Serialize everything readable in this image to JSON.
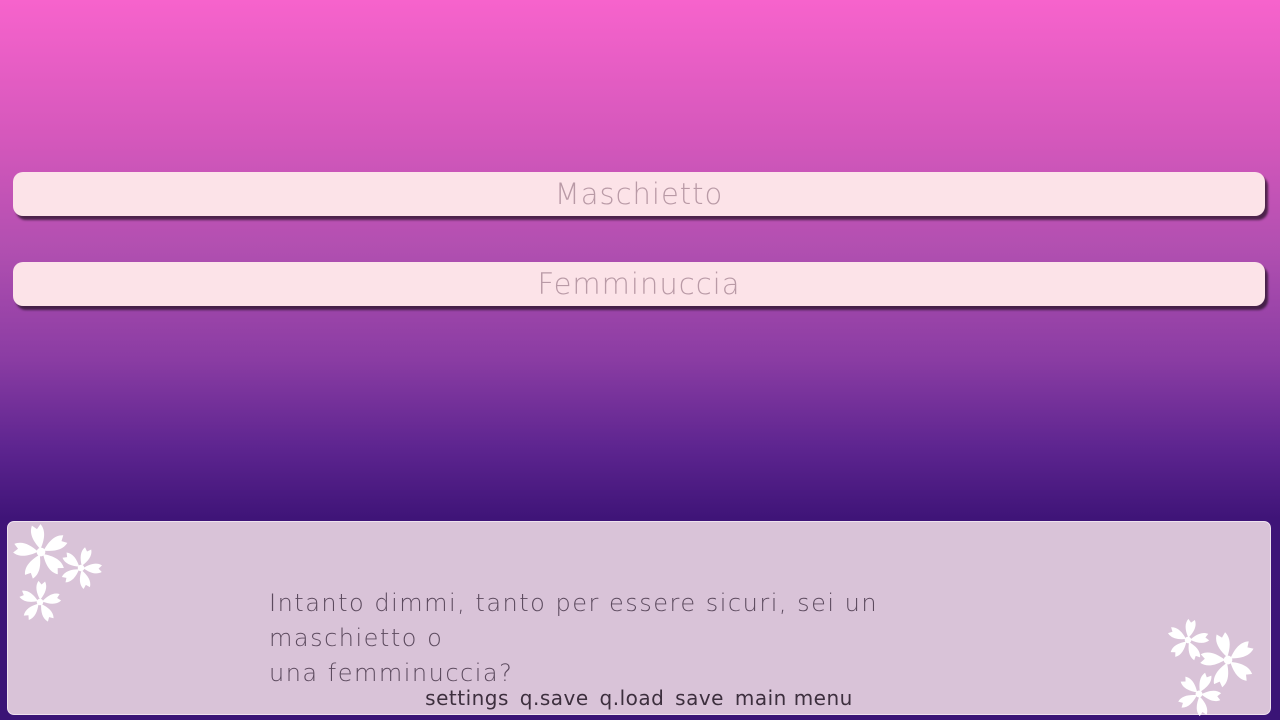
{
  "choices": [
    {
      "label": "Maschietto"
    },
    {
      "label": "Femminuccia"
    }
  ],
  "dialogue": {
    "line1": "Intanto dimmi, tanto per essere sicuri, sei un maschietto o",
    "line2": "una femminuccia?"
  },
  "quick_menu": {
    "settings": "settings",
    "qsave": "q.save",
    "qload": "q.load",
    "save": "save",
    "main_menu": "main menu"
  },
  "colors": {
    "bg_top": "#f763cc",
    "bg_bottom": "#3a1476",
    "choice_bg": "#fce3e8",
    "choice_text": "#b99aa6",
    "textbox_bg": "#d9c3d8",
    "dialogue_text": "#5c4a5e"
  },
  "icons": [
    "sakura-flower-icon"
  ]
}
